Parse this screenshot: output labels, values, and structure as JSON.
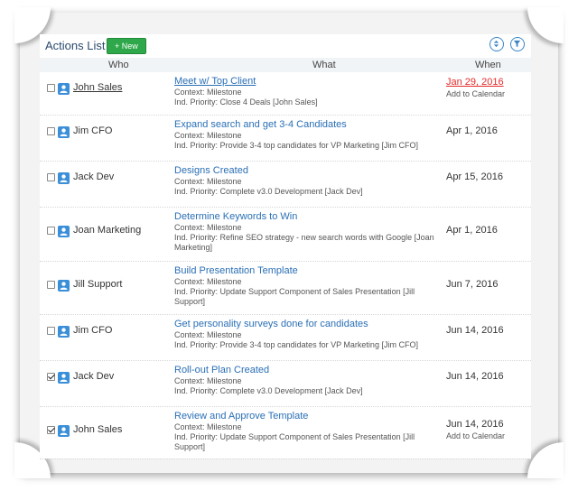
{
  "header": {
    "title": "Actions List",
    "new_button": "+ New",
    "sort_icon": "sort-icon",
    "filter_icon": "filter-icon"
  },
  "columns": {
    "who": "Who",
    "what": "What",
    "when": "When"
  },
  "colors": {
    "accent": "#2a6fb5",
    "new_button": "#2ea84a",
    "overdue": "#e22a2a"
  },
  "rows": [
    {
      "checked": false,
      "who": "John Sales",
      "who_link": true,
      "title": "Meet w/ Top Client",
      "title_underline": true,
      "context": "Context: Milestone",
      "priority": "Ind. Priority: Close 4 Deals [John Sales]",
      "priority2": "",
      "date": "Jan 29, 2016",
      "overdue": true,
      "calendar": "Add to Calendar"
    },
    {
      "checked": false,
      "who": "Jim CFO",
      "who_link": false,
      "title": "Expand search and get 3-4 Candidates",
      "title_underline": false,
      "context": "Context: Milestone",
      "priority": "Ind. Priority: Provide 3-4 top candidates for VP Marketing [Jim CFO]",
      "priority2": "",
      "date": "Apr 1, 2016",
      "overdue": false,
      "calendar": ""
    },
    {
      "checked": false,
      "who": "Jack Dev",
      "who_link": false,
      "title": "Designs Created",
      "title_underline": false,
      "context": "Context: Milestone",
      "priority": "Ind. Priority: Complete v3.0 Development [Jack Dev]",
      "priority2": "",
      "date": "Apr 15, 2016",
      "overdue": false,
      "calendar": ""
    },
    {
      "checked": false,
      "who": "Joan Marketing",
      "who_link": false,
      "title": "Determine Keywords to Win",
      "title_underline": false,
      "context": "Context: Milestone",
      "priority": "Ind. Priority: Refine SEO strategy - new search words with Google [Joan",
      "priority2": "Marketing]",
      "date": "Apr 1, 2016",
      "overdue": false,
      "calendar": ""
    },
    {
      "checked": false,
      "who": "Jill Support",
      "who_link": false,
      "title": "Build Presentation Template",
      "title_underline": false,
      "context": "Context: Milestone",
      "priority": "Ind. Priority: Update Support Component of Sales Presentation [Jill",
      "priority2": "Support]",
      "date": "Jun 7, 2016",
      "overdue": false,
      "calendar": ""
    },
    {
      "checked": false,
      "who": "Jim CFO",
      "who_link": false,
      "title": "Get personality surveys done for candidates",
      "title_underline": false,
      "context": "Context: Milestone",
      "priority": "Ind. Priority: Provide 3-4 top candidates for VP Marketing [Jim CFO]",
      "priority2": "",
      "date": "Jun 14, 2016",
      "overdue": false,
      "calendar": ""
    },
    {
      "checked": true,
      "who": "Jack Dev",
      "who_link": false,
      "title": "Roll-out Plan Created",
      "title_underline": false,
      "context": "Context: Milestone",
      "priority": "Ind. Priority: Complete v3.0 Development [Jack Dev]",
      "priority2": "",
      "date": "Jun 14, 2016",
      "overdue": false,
      "calendar": ""
    },
    {
      "checked": true,
      "who": "John Sales",
      "who_link": false,
      "title": "Review and Approve Template",
      "title_underline": false,
      "context": "Context: Milestone",
      "priority": "Ind. Priority: Update Support Component of Sales Presentation [Jill",
      "priority2": "Support]",
      "date": "Jun 14, 2016",
      "overdue": false,
      "calendar": "Add to Calendar"
    }
  ]
}
